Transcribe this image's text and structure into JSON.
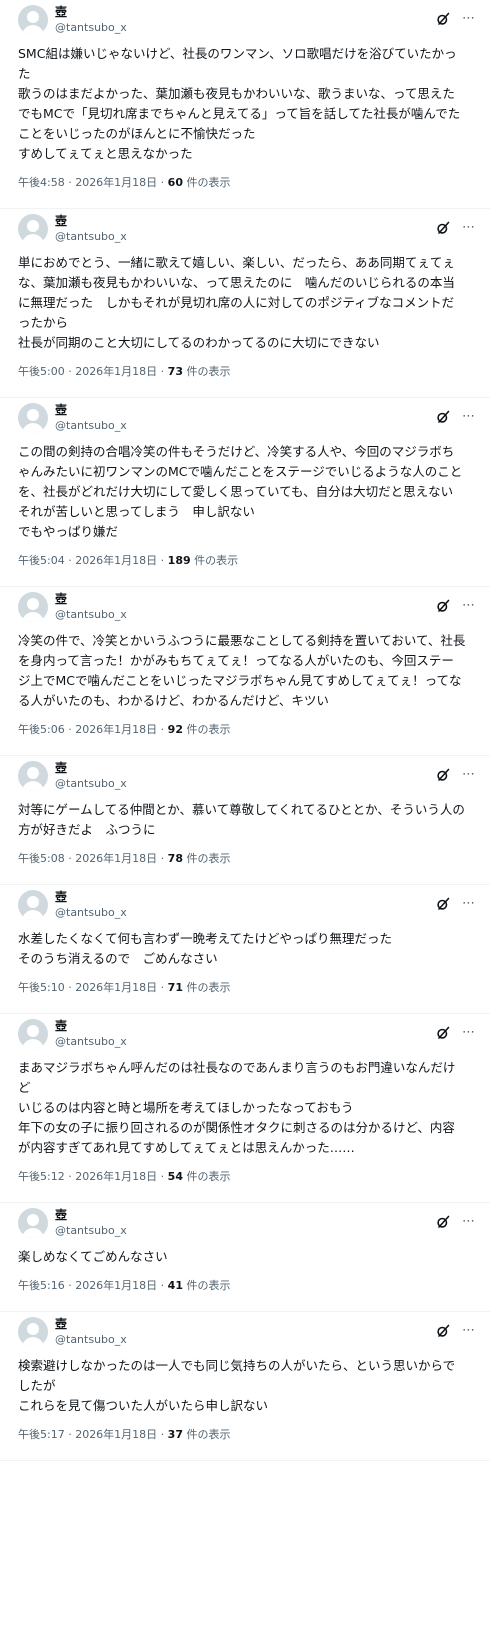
{
  "author": {
    "display_name": "壺",
    "handle": "@tantsubo_x",
    "grok_icon": "grok-icon",
    "more_icon": "more-icon",
    "more_glyph": "⋯"
  },
  "views_suffix": " 件の表示",
  "tweets": [
    {
      "text": "SMC組は嫌いじゃないけど、社長のワンマン、ソロ歌唱だけを浴びていたかった\n歌うのはまだよかった、葉加瀬も夜見もかわいいな、歌うまいな、って思えた\nでもMCで「見切れ席までちゃんと見えてる」って旨を話してた社長が噛んでたことをいじったのがほんとに不愉快だった\nすめしてぇてぇと思えなかった",
      "time": "午後4:58 · 2026年1月18日 · ",
      "views": "60"
    },
    {
      "text": "単におめでとう、一緒に歌えて嬉しい、楽しい、だったら、ああ同期てぇてぇな、葉加瀬も夜見もかわいいな、って思えたのに　噛んだのいじられるの本当に無理だった　しかもそれが見切れ席の人に対してのポジティブなコメントだったから\n社長が同期のこと大切にしてるのわかってるのに大切にできない",
      "time": "午後5:00 · 2026年1月18日 · ",
      "views": "73"
    },
    {
      "text": "この間の剣持の合唱冷笑の件もそうだけど、冷笑する人や、今回のマジラボちゃんみたいに初ワンマンのMCで噛んだことをステージでいじるような人のことを、社長がどれだけ大切にして愛しく思っていても、自分は大切だと思えない　それが苦しいと思ってしまう　申し訳ない\nでもやっぱり嫌だ",
      "time": "午後5:04 · 2026年1月18日 · ",
      "views": "189"
    },
    {
      "text": "冷笑の件で、冷笑とかいうふつうに最悪なことしてる剣持を置いておいて、社長を身内って言った！かがみもちてぇてぇ！ってなる人がいたのも、今回ステージ上でMCで噛んだことをいじったマジラボちゃん見てすめしてぇてぇ！ってなる人がいたのも、わかるけど、わかるんだけど、キツい",
      "time": "午後5:06 · 2026年1月18日 · ",
      "views": "92"
    },
    {
      "text": "対等にゲームしてる仲間とか、慕いて尊敬してくれてるひととか、そういう人の方が好きだよ　ふつうに",
      "time": "午後5:08 · 2026年1月18日 · ",
      "views": "78"
    },
    {
      "text": "水差したくなくて何も言わず一晩考えてたけどやっぱり無理だった\nそのうち消えるので　ごめんなさい",
      "time": "午後5:10 · 2026年1月18日 · ",
      "views": "71"
    },
    {
      "text": "まあマジラボちゃん呼んだのは社長なのであんまり言うのもお門違いなんだけど\nいじるのは内容と時と場所を考えてほしかったなっておもう\n年下の女の子に振り回されるのが関係性オタクに刺さるのは分かるけど、内容が内容すぎてあれ見てすめしてぇてぇとは思えんかった……",
      "time": "午後5:12 · 2026年1月18日 · ",
      "views": "54"
    },
    {
      "text": "楽しめなくてごめんなさい",
      "time": "午後5:16 · 2026年1月18日 · ",
      "views": "41"
    },
    {
      "text": "検索避けしなかったのは一人でも同じ気持ちの人がいたら、という思いからでしたが\nこれらを見て傷ついた人がいたら申し訳ない",
      "time": "午後5:17 · 2026年1月18日 · ",
      "views": "37"
    }
  ]
}
